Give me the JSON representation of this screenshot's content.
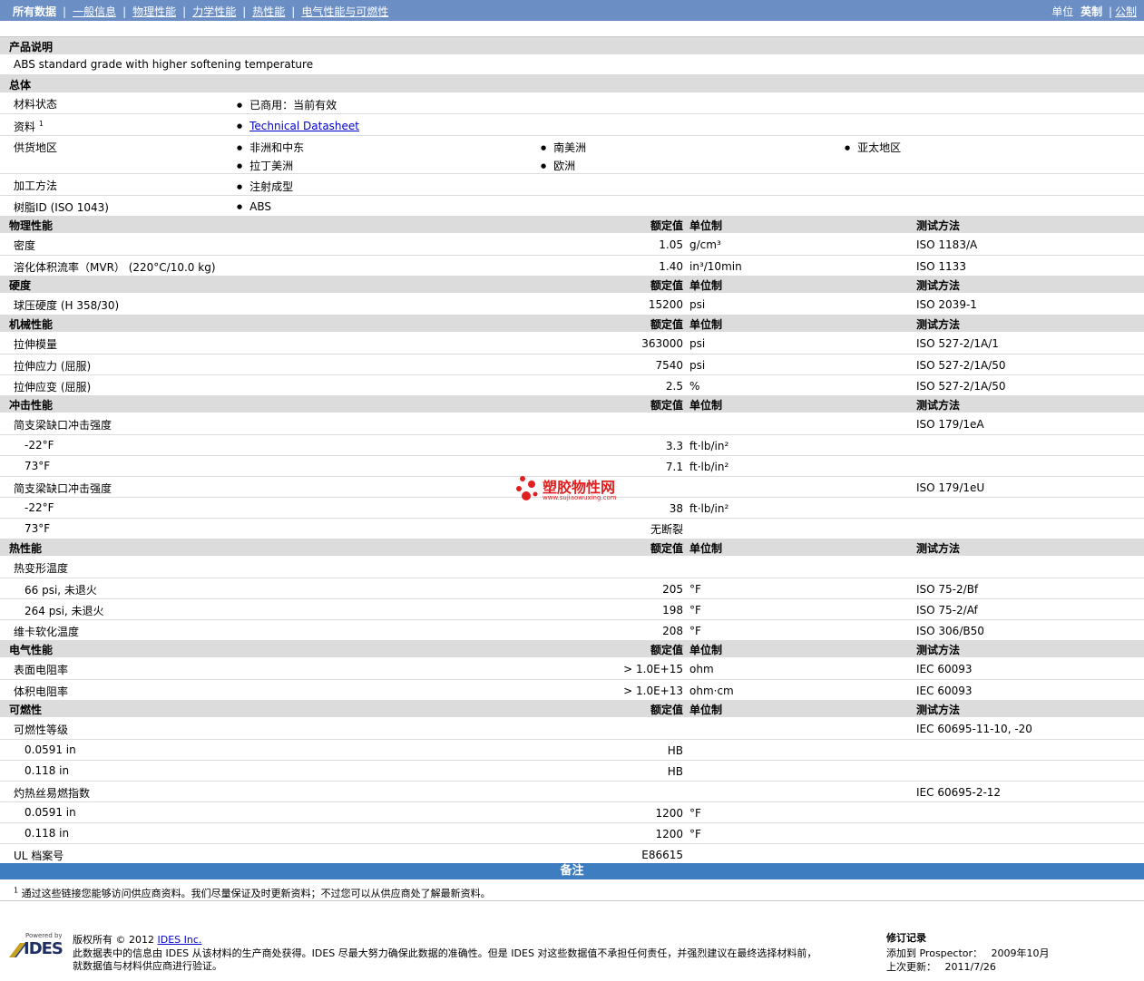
{
  "nav": {
    "items": [
      "所有数据",
      "一般信息",
      "物理性能",
      "力学性能",
      "热性能",
      "电气性能与可燃性"
    ],
    "units_label": "单位",
    "units_english": "英制",
    "units_metric": "公制"
  },
  "product": {
    "header": "产品说明",
    "description": "ABS standard grade with higher softening temperature"
  },
  "general": {
    "header": "总体",
    "material_status_label": "材料状态",
    "material_status": "已商用：当前有效",
    "resources_label": "资料",
    "resources_sup": "1",
    "resources_link": "Technical Datasheet",
    "availability_label": "供货地区",
    "regions": [
      "非洲和中东",
      "南美洲",
      "亚太地区",
      "拉丁美洲",
      "欧洲"
    ],
    "processing_label": "加工方法",
    "processing": "注射成型",
    "resin_id_label": "树脂ID (ISO 1043)",
    "resin_id": "ABS"
  },
  "columns": {
    "nominal": "额定值",
    "unit": "单位制",
    "method": "测试方法"
  },
  "sections": {
    "physical": {
      "header": "物理性能",
      "rows": [
        {
          "label": "密度",
          "value": "1.05",
          "unit": "g/cm³",
          "method": "ISO 1183/A"
        },
        {
          "label": "溶化体积流率（MVR） (220°C/10.0 kg)",
          "value": "1.40",
          "unit": "in³/10min",
          "method": "ISO 1133"
        }
      ]
    },
    "hardness": {
      "header": "硬度",
      "rows": [
        {
          "label": "球压硬度 (H 358/30)",
          "value": "15200",
          "unit": "psi",
          "method": "ISO 2039-1"
        }
      ]
    },
    "mechanical": {
      "header": "机械性能",
      "rows": [
        {
          "label": "拉伸模量",
          "value": "363000",
          "unit": "psi",
          "method": "ISO 527-2/1A/1"
        },
        {
          "label": "拉伸应力 (屈服)",
          "value": "7540",
          "unit": "psi",
          "method": "ISO 527-2/1A/50"
        },
        {
          "label": "拉伸应变 (屈服)",
          "value": "2.5",
          "unit": "%",
          "method": "ISO 527-2/1A/50"
        }
      ]
    },
    "impact": {
      "header": "冲击性能",
      "rows": [
        {
          "label": "简支梁缺口冲击强度",
          "value": "",
          "unit": "",
          "method": "ISO 179/1eA"
        },
        {
          "label": "-22°F",
          "value": "3.3",
          "unit": "ft·lb/in²",
          "method": ""
        },
        {
          "label": "73°F",
          "value": "7.1",
          "unit": "ft·lb/in²",
          "method": ""
        },
        {
          "label": "简支梁缺口冲击强度",
          "value": "",
          "unit": "",
          "method": "ISO 179/1eU"
        },
        {
          "label": "-22°F",
          "value": "38",
          "unit": "ft·lb/in²",
          "method": ""
        },
        {
          "label": "73°F",
          "value": "无断裂",
          "unit": "",
          "method": ""
        }
      ]
    },
    "thermal": {
      "header": "热性能",
      "rows": [
        {
          "label": "热变形温度",
          "value": "",
          "unit": "",
          "method": ""
        },
        {
          "label": "66 psi, 未退火",
          "value": "205",
          "unit": "°F",
          "method": "ISO 75-2/Bf"
        },
        {
          "label": "264 psi, 未退火",
          "value": "198",
          "unit": "°F",
          "method": "ISO 75-2/Af"
        },
        {
          "label": "维卡软化温度",
          "value": "208",
          "unit": "°F",
          "method": "ISO 306/B50"
        }
      ]
    },
    "electrical": {
      "header": "电气性能",
      "rows": [
        {
          "label": "表面电阻率",
          "value": "> 1.0E+15",
          "unit": "ohm",
          "method": "IEC 60093"
        },
        {
          "label": "体积电阻率",
          "value": "> 1.0E+13",
          "unit": "ohm·cm",
          "method": "IEC 60093"
        }
      ]
    },
    "flammability": {
      "header": "可燃性",
      "rows": [
        {
          "label": "可燃性等级",
          "value": "",
          "unit": "",
          "method": "IEC 60695-11-10, -20"
        },
        {
          "label": "0.0591 in",
          "value": "HB",
          "unit": "",
          "method": ""
        },
        {
          "label": "0.118 in",
          "value": "HB",
          "unit": "",
          "method": ""
        },
        {
          "label": "灼热丝易燃指数",
          "value": "",
          "unit": "",
          "method": "IEC 60695-2-12"
        },
        {
          "label": "0.0591 in",
          "value": "1200",
          "unit": "°F",
          "method": ""
        },
        {
          "label": "0.118 in",
          "value": "1200",
          "unit": "°F",
          "method": ""
        },
        {
          "label": "UL 档案号",
          "value": "E86615",
          "unit": "",
          "method": ""
        }
      ]
    }
  },
  "notes": {
    "header": "备注",
    "footnote_num": "1",
    "footnote": "通过这些链接您能够访问供应商资料。我们尽量保证及时更新资料；不过您可以从供应商处了解最新资料。"
  },
  "watermark": {
    "text": "塑胶物性网",
    "url": "www.sujiaowuxing.com"
  },
  "footer": {
    "powered_by": "Powered by",
    "logo_text": "IDES",
    "copyright_prefix": "版权所有 © 2012",
    "copyright_link": "IDES Inc.",
    "disclaimer_1": "此数据表中的信息由 IDES 从该材料的生产商处获得。IDES 尽最大努力确保此数据的准确性。但是 IDES 对这些数据值不承担任何责任，并强烈建议在最终选择材料前，",
    "disclaimer_2": "就数据值与材料供应商进行验证。",
    "revision_title": "修订记录",
    "added_label": "添加到 Prospector：",
    "added_date": "2009年10月",
    "updated_label": "上次更新：",
    "updated_date": "2011/7/26"
  },
  "colors": {
    "topbar": "#6b8ec5",
    "section_header": "#dcdcdc",
    "notes_bar": "#3e7dbf",
    "link": "#0000cc"
  }
}
